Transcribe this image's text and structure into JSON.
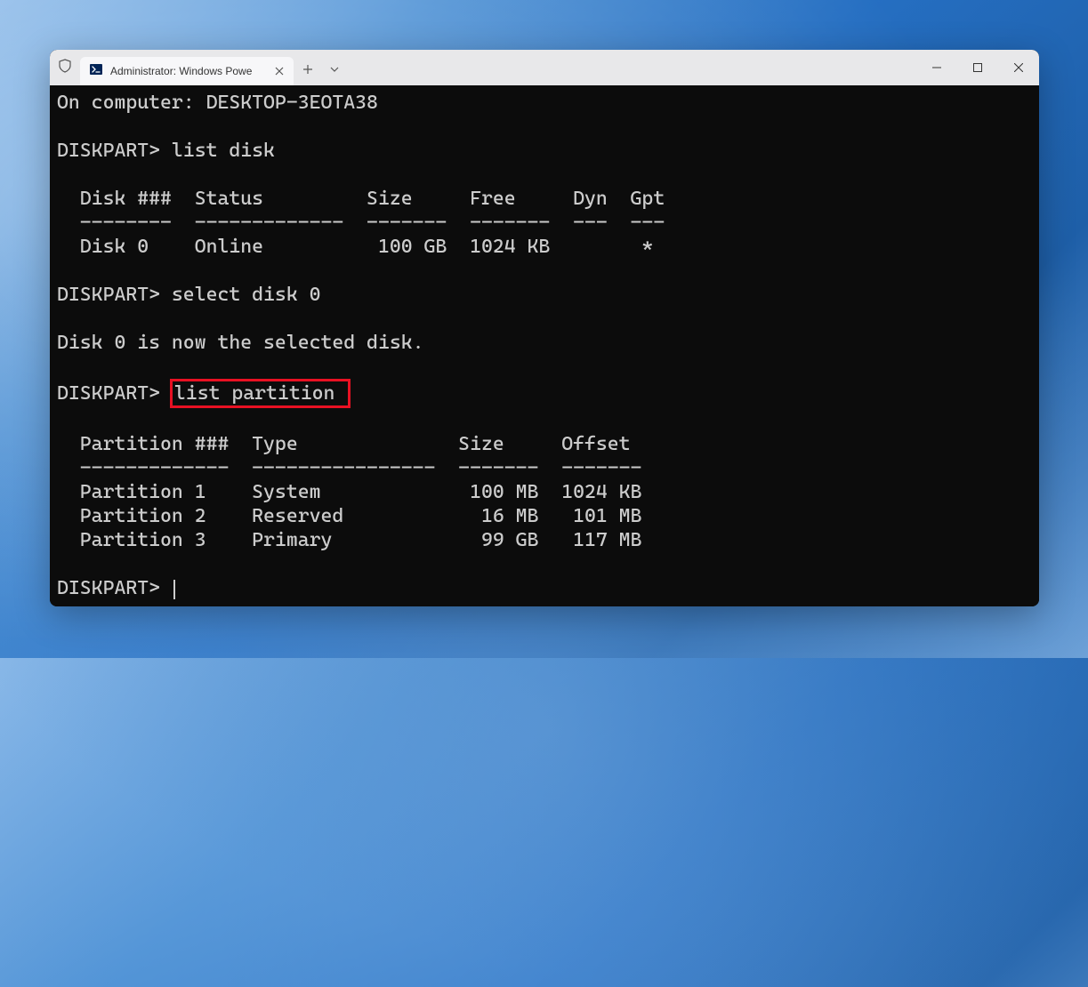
{
  "window": {
    "tab_title": "Administrator: Windows Powe",
    "shield_icon": "shield-icon",
    "ps_icon": "powershell-icon"
  },
  "terminal": {
    "line_computer": "On computer: DESKTOP-3EOTA38",
    "prompt1": "DISKPART> ",
    "cmd1": "list disk",
    "disk_header": "  Disk ###  Status         Size     Free     Dyn  Gpt",
    "disk_divider": "  --------  -------------  -------  -------  ---  ---",
    "disk_row1": "  Disk 0    Online          100 GB  1024 KB        *",
    "prompt2": "DISKPART> ",
    "cmd2": "select disk 0",
    "select_msg": "Disk 0 is now the selected disk.",
    "prompt3": "DISKPART> ",
    "cmd3": "list partition",
    "part_header": "  Partition ###  Type              Size     Offset",
    "part_divider": "  -------------  ----------------  -------  -------",
    "part_row1": "  Partition 1    System             100 MB  1024 KB",
    "part_row2": "  Partition 2    Reserved            16 MB   101 MB",
    "part_row3": "  Partition 3    Primary             99 GB   117 MB",
    "prompt4": "DISKPART> "
  }
}
